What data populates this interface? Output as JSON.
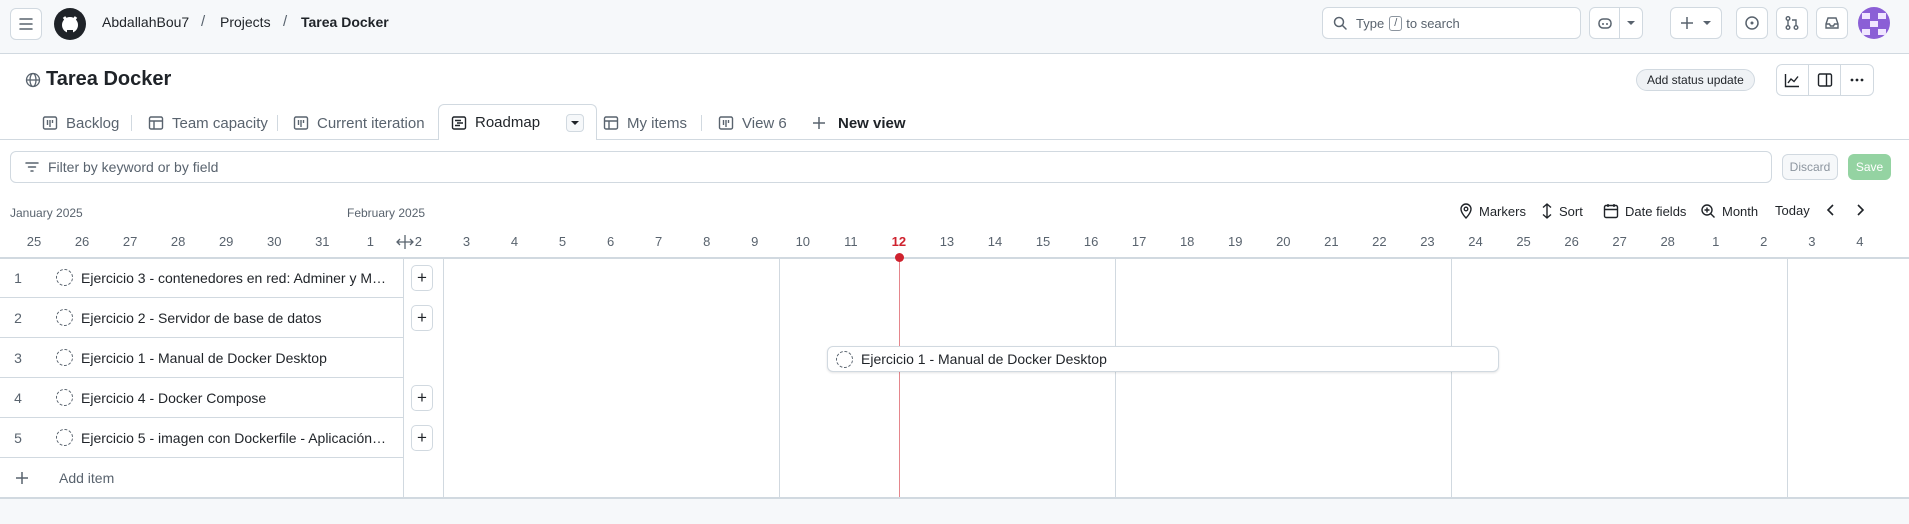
{
  "header": {
    "owner": "AbdallahBou7",
    "sep1": "/",
    "projects": "Projects",
    "sep2": "/",
    "project": "Tarea Docker",
    "search_type": "Type",
    "search_key": "/",
    "search_rest": "to search"
  },
  "page": {
    "title": "Tarea Docker",
    "status_button": "Add status update"
  },
  "tabs": [
    {
      "label": "Backlog",
      "icon": "board-icon"
    },
    {
      "label": "Team capacity",
      "icon": "table-icon"
    },
    {
      "label": "Current iteration",
      "icon": "board-icon"
    },
    {
      "label": "Roadmap",
      "icon": "roadmap-icon"
    },
    {
      "label": "My items",
      "icon": "table-icon"
    },
    {
      "label": "View 6",
      "icon": "board-icon"
    },
    {
      "label": "New view",
      "icon": "plus-icon"
    }
  ],
  "filter": {
    "placeholder": "Filter by keyword or by field",
    "discard": "Discard",
    "save": "Save"
  },
  "timeline": {
    "month1": "January 2025",
    "month2": "February 2025",
    "controls": {
      "markers": "Markers",
      "sort": "Sort",
      "date_fields": "Date fields",
      "zoom": "Month",
      "today": "Today"
    },
    "days": [
      "25",
      "26",
      "27",
      "28",
      "29",
      "30",
      "31",
      "1",
      "2",
      "3",
      "4",
      "5",
      "6",
      "7",
      "8",
      "9",
      "10",
      "11",
      "12",
      "13",
      "14",
      "15",
      "16",
      "17",
      "18",
      "19",
      "20",
      "21",
      "22",
      "23",
      "24",
      "25",
      "26",
      "27",
      "28",
      "1",
      "2",
      "3",
      "4"
    ],
    "today_day": "12"
  },
  "items": [
    {
      "num": "1",
      "title": "Ejercicio 3 - contenedores en red: Adminer y M…",
      "has_add": true
    },
    {
      "num": "2",
      "title": "Ejercicio 2 - Servidor de base de datos",
      "has_add": true
    },
    {
      "num": "3",
      "title": "Ejercicio 1 - Manual de Docker Desktop",
      "has_add": false
    },
    {
      "num": "4",
      "title": "Ejercicio 4 - Docker Compose",
      "has_add": true
    },
    {
      "num": "5",
      "title": "Ejercicio 5 - imagen con Dockerfile - Aplicación…",
      "has_add": true
    }
  ],
  "add_item": "Add item",
  "bar": {
    "label": "Ejercicio 1 - Manual de Docker Desktop"
  },
  "colors": {
    "today_line": "#cf222e",
    "border": "#d1d9e0",
    "save_bg": "#94d3a2"
  }
}
